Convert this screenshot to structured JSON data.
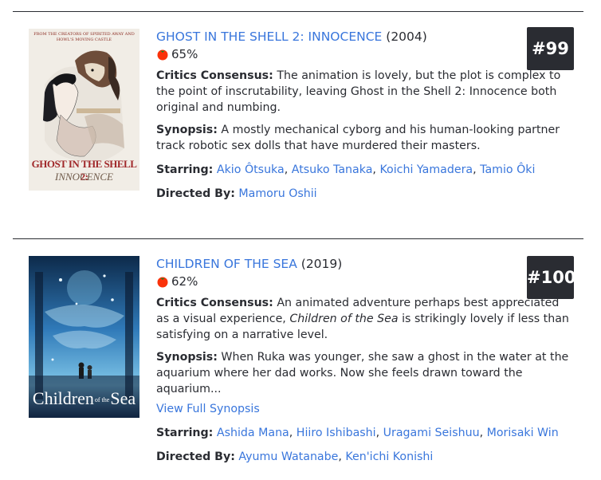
{
  "entries": [
    {
      "title": "GHOST IN THE SHELL 2: INNOCENCE",
      "year": "(2004)",
      "score": "65%",
      "rank": "#99",
      "consensus_label": "Critics Consensus:",
      "consensus": "The animation is lovely, but the plot is complex to the point of inscrutability, leaving Ghost in the Shell 2: Innocence both original and numbing.",
      "synopsis_label": "Synopsis:",
      "synopsis": "A mostly mechanical cyborg and his human-looking partner track robotic sex dolls that have murdered their masters.",
      "starring_label": "Starring:",
      "starring": [
        "Akio Ôtsuka",
        "Atsuko Tanaka",
        "Koichi Yamadera",
        "Tamio Ôki"
      ],
      "directed_label": "Directed By:",
      "directors": [
        "Mamoru Oshii"
      ],
      "poster": {
        "tagline": "FROM THE CREATORS OF SPIRITED AWAY AND HOWL'S MOVING CASTLE",
        "title_line1": "GHOST IN THE SHELL 2:",
        "title_line2": "INNOCENCE"
      }
    },
    {
      "title": "CHILDREN OF THE SEA",
      "year": "(2019)",
      "score": "62%",
      "rank": "#100",
      "consensus_label": "Critics Consensus:",
      "consensus_pre": "An animated adventure perhaps best appreciated as a visual experience, ",
      "consensus_italic": "Children of the Sea",
      "consensus_post": " is strikingly lovely if less than satisfying on a narrative level.",
      "synopsis_label": "Synopsis:",
      "synopsis": "When Ruka was younger, she saw a ghost in the water at the aquarium where her dad works. Now she feels drawn toward the aquarium...",
      "view_full": "View Full Synopsis",
      "starring_label": "Starring:",
      "starring": [
        "Ashida Mana",
        "Hiiro Ishibashi",
        "Uragami Seishuu",
        "Morisaki Win"
      ],
      "directed_label": "Directed By:",
      "directors": [
        "Ayumu Watanabe",
        "Ken'ichi Konishi"
      ],
      "poster": {
        "title_word1": "Children",
        "title_small": "of the",
        "title_word2": "Sea"
      }
    }
  ],
  "colors": {
    "link": "#3976dc",
    "text": "#2a2c32",
    "rank_bg": "#2a2c32",
    "tomato": "#fa320a"
  }
}
